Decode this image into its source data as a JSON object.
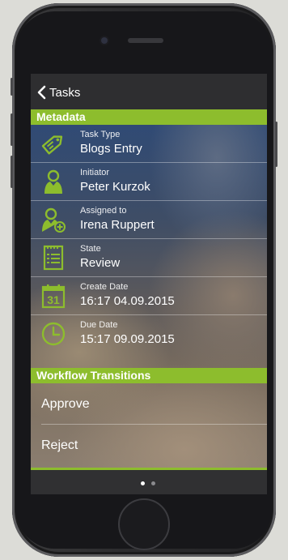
{
  "nav": {
    "back_label": "Tasks"
  },
  "metadata": {
    "header": "Metadata",
    "rows": [
      {
        "label": "Task Type",
        "value": "Blogs Entry",
        "icon": "tag-icon"
      },
      {
        "label": "Initiator",
        "value": "Peter Kurzok",
        "icon": "user-icon"
      },
      {
        "label": "Assigned to",
        "value": "Irena Ruppert",
        "icon": "user-add-icon"
      },
      {
        "label": "State",
        "value": "Review",
        "icon": "clipboard-list-icon"
      },
      {
        "label": "Create Date",
        "value": "16:17 04.09.2015",
        "icon": "calendar-icon",
        "calendar_day": "31"
      },
      {
        "label": "Due Date",
        "value": "15:17 09.09.2015",
        "icon": "clock-icon"
      }
    ]
  },
  "workflow": {
    "header": "Workflow Transitions",
    "transitions": [
      "Approve",
      "Reject"
    ]
  },
  "pagination": {
    "current": 1,
    "total": 2
  },
  "colors": {
    "accent": "#8dbd2d",
    "nav_bg": "#2e2e30",
    "text": "#ffffff"
  }
}
